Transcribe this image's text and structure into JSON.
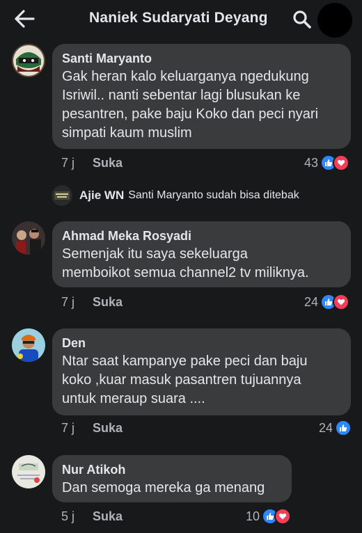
{
  "header": {
    "title": "Naniek Sudaryati Deyang"
  },
  "comments": [
    {
      "author": "Santi Maryanto",
      "text_lines": [
        "Gak heran kalo keluarganya ngedukung",
        "Isriwil.. nanti sebentar lagi blusukan ke",
        "pesantren, pake baju Koko dan peci nyari",
        "simpati kaum muslim"
      ],
      "time": "7 j",
      "like_label": "Suka",
      "reaction_count": "43",
      "reactions": [
        "like",
        "love"
      ]
    },
    {
      "author": "Ahmad Meka Rosyadi",
      "text_lines": [
        "Semenjak itu saya sekeluarga",
        "memboikot semua channel2 tv miliknya."
      ],
      "time": "7 j",
      "like_label": "Suka",
      "reaction_count": "24",
      "reactions": [
        "like",
        "love"
      ]
    },
    {
      "author": "Den",
      "text_lines": [
        "Ntar saat kampanye pake peci dan baju",
        "koko ,kuar masuk pasantren tujuannya",
        "untuk meraup suara ...."
      ],
      "time": "7 j",
      "like_label": "Suka",
      "reaction_count": "24",
      "reactions": [
        "like"
      ]
    },
    {
      "author": "Nur Atikoh",
      "text_lines": [
        "Dan semoga mereka ga menang"
      ],
      "time": "5 j",
      "like_label": "Suka",
      "reaction_count": "10",
      "reactions": [
        "like",
        "love"
      ]
    }
  ],
  "reply": {
    "author": "Ajie WN",
    "text": "Santi Maryanto sudah bisa ditebak"
  }
}
